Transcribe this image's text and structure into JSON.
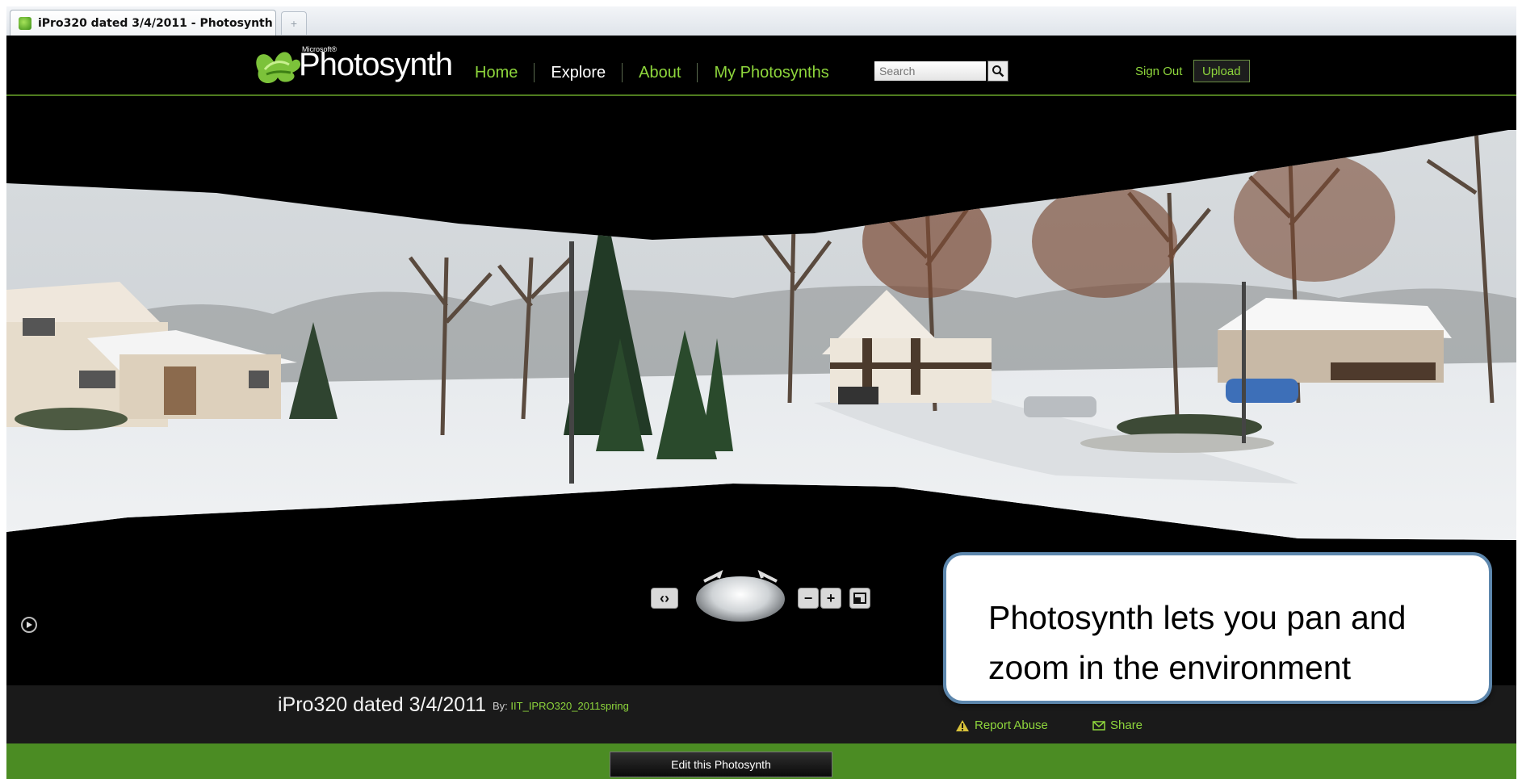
{
  "browser": {
    "tab_title": "iPro320 dated 3/4/2011 - Photosynth",
    "new_tab_symbol": "+"
  },
  "header": {
    "logo_small": "Microsoft®",
    "logo_text": "Photosynth",
    "nav": [
      {
        "label": "Home",
        "active": false
      },
      {
        "label": "Explore",
        "active": true
      },
      {
        "label": "About",
        "active": false
      },
      {
        "label": "My Photosynths",
        "active": false
      }
    ],
    "search_placeholder": "Search",
    "sign_out": "Sign Out",
    "upload": "Upload"
  },
  "viewer": {
    "scene": "panorama-winter-neighborhood",
    "controls": {
      "pan_toggle": "‹›",
      "zoom_out": "−",
      "zoom_in": "+",
      "fullscreen_icon": "fullscreen-icon"
    }
  },
  "synth": {
    "title": "iPro320 dated 3/4/2011",
    "by_label": "By:",
    "author": "IIT_IPRO320_2011spring",
    "report_abuse": "Report Abuse",
    "share": "Share"
  },
  "footer": {
    "edit_button": "Edit this Photosynth"
  },
  "callout": {
    "text": "Photosynth lets you pan and zoom in the environment"
  },
  "colors": {
    "brand_green": "#8ed63c",
    "footer_green": "#4b8c23",
    "callout_border": "#5d87ad"
  }
}
